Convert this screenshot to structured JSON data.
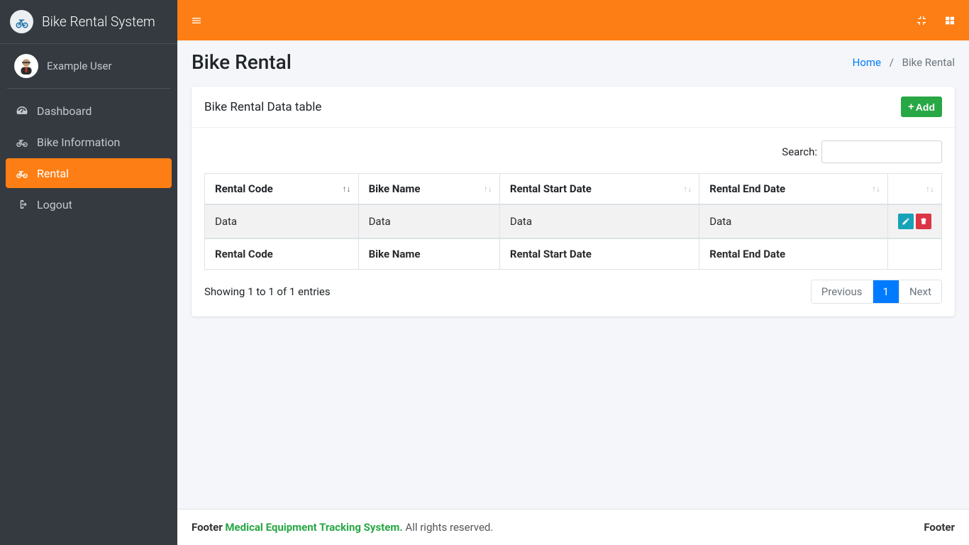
{
  "brand": {
    "title": "Bike Rental System"
  },
  "user": {
    "name": "Example User"
  },
  "sidebar": {
    "items": [
      {
        "label": "Dashboard"
      },
      {
        "label": "Bike Information"
      },
      {
        "label": "Rental"
      },
      {
        "label": "Logout"
      }
    ]
  },
  "page": {
    "title": "Bike Rental",
    "breadcrumb_home": "Home",
    "breadcrumb_current": "Bike Rental"
  },
  "card": {
    "title": "Bike Rental Data table",
    "add_label": "Add"
  },
  "search": {
    "label": "Search:",
    "value": ""
  },
  "table": {
    "columns": [
      "Rental Code",
      "Bike Name",
      "Rental Start Date",
      "Rental End Date"
    ],
    "rows": [
      {
        "rental_code": "Data",
        "bike_name": "Data",
        "start_date": "Data",
        "end_date": "Data"
      }
    ],
    "foot_columns": [
      "Rental Code",
      "Bike Name",
      "Rental Start Date",
      "Rental End Date"
    ],
    "info": "Showing 1 to 1 of 1 entries",
    "pagination": {
      "prev": "Previous",
      "page": "1",
      "next": "Next"
    }
  },
  "footer": {
    "left_prefix": "Footer ",
    "left_link": "Medical Equipment Tracking System.",
    "left_suffix": " All rights reserved.",
    "right": "Footer"
  }
}
